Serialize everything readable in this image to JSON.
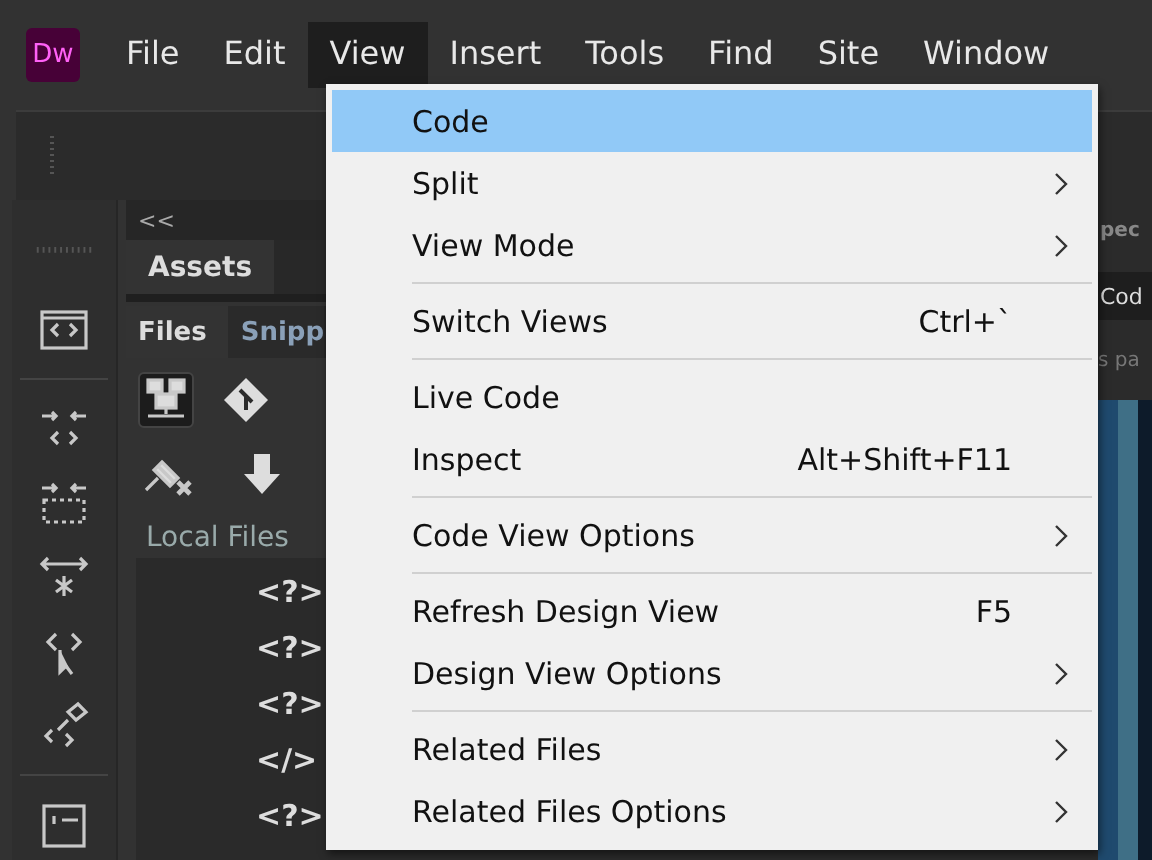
{
  "logo": "Dw",
  "menubar": [
    {
      "label": "File",
      "selected": false
    },
    {
      "label": "Edit",
      "selected": false
    },
    {
      "label": "View",
      "selected": true
    },
    {
      "label": "Insert",
      "selected": false
    },
    {
      "label": "Tools",
      "selected": false
    },
    {
      "label": "Find",
      "selected": false
    },
    {
      "label": "Site",
      "selected": false
    },
    {
      "label": "Window",
      "selected": false
    }
  ],
  "menu": [
    {
      "kind": "item",
      "label": "Code",
      "selected": true,
      "submenu": false
    },
    {
      "kind": "item",
      "label": "Split",
      "selected": false,
      "submenu": true
    },
    {
      "kind": "item",
      "label": "View Mode",
      "selected": false,
      "submenu": true
    },
    {
      "kind": "separator"
    },
    {
      "kind": "item",
      "label": "Switch Views",
      "shortcut": "Ctrl+`",
      "selected": false,
      "submenu": false
    },
    {
      "kind": "separator"
    },
    {
      "kind": "item",
      "label": "Live Code",
      "selected": false,
      "submenu": false
    },
    {
      "kind": "item",
      "label": "Inspect",
      "shortcut": "Alt+Shift+F11",
      "selected": false,
      "submenu": false
    },
    {
      "kind": "separator"
    },
    {
      "kind": "item",
      "label": "Code View Options",
      "selected": false,
      "submenu": true
    },
    {
      "kind": "separator"
    },
    {
      "kind": "item",
      "label": "Refresh Design View",
      "shortcut": "F5",
      "selected": false,
      "submenu": false
    },
    {
      "kind": "item",
      "label": "Design View Options",
      "selected": false,
      "submenu": true
    },
    {
      "kind": "separator"
    },
    {
      "kind": "item",
      "label": "Related Files",
      "selected": false,
      "submenu": true
    },
    {
      "kind": "item",
      "label": "Related Files Options",
      "selected": false,
      "submenu": true
    }
  ],
  "panel": {
    "collapse": "<<",
    "tab": "Assets",
    "file_tabs": [
      {
        "label": "Files",
        "selected": true
      },
      {
        "label": "Snipp",
        "selected": false
      }
    ],
    "location": "Local Files",
    "files": [
      {
        "icon": "<?>"
      },
      {
        "icon": "<?>"
      },
      {
        "icon": "<?>"
      },
      {
        "icon": "</>"
      },
      {
        "icon": "<?>"
      }
    ]
  },
  "right_panel": {
    "tab": "pec",
    "field": "Cod",
    "hint": "s pa"
  }
}
